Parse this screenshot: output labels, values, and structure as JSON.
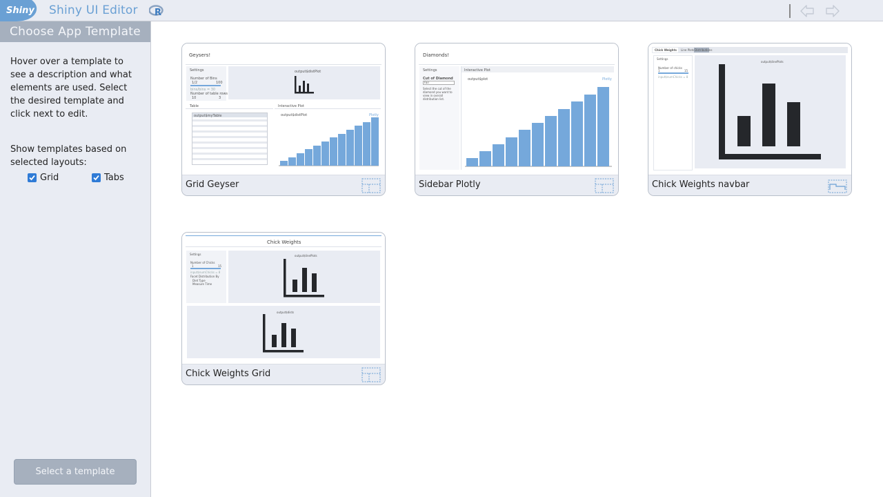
{
  "header": {
    "logo_text": "Shiny",
    "title": "Shiny UI Editor",
    "r_icon_text": "R",
    "icons": [
      "r-logo-icon",
      "undo-arrow-icon",
      "redo-arrow-icon"
    ]
  },
  "sidebar": {
    "title": "Choose App Template",
    "description": "Hover over a template to see a description and what elements are used. Select the desired template and click next to edit.",
    "layouts_text": "Show templates based on selected layouts:",
    "checkboxes": [
      {
        "label": "Grid",
        "checked": true
      },
      {
        "label": "Tabs",
        "checked": true
      }
    ],
    "select_button": "Select a template"
  },
  "templates": [
    {
      "name": "Grid Geyser",
      "layout_icon": "grid-layout-icon",
      "preview": {
        "title": "Geysers!",
        "settings_label": "Settings",
        "bins_label": "Number of Bins",
        "bins_min": "1/2",
        "bins_max": "100",
        "bins_note": "bins/bins = 30",
        "rows_label": "Number of table rows",
        "rows_min": "10",
        "rows_max": "3",
        "plot_label": "output$distPlot",
        "table_title": "Table",
        "table_label": "output$myTable",
        "interactive_title": "Interactive Plot",
        "interactive_label": "output$distPlot",
        "plotly_label": "Plotly"
      }
    },
    {
      "name": "Sidebar Plotly",
      "layout_icon": "grid-layout-icon",
      "preview": {
        "title": "Diamonds!",
        "settings_label": "Settings",
        "cut_label": "Cut of Diamond",
        "cut_value": "Fair",
        "cut_help": "Select the cut of the diamond you want to view in overall distribution list.",
        "plot_title": "Interactive Plot",
        "plot_label": "output$plot",
        "plotly_label": "Plotly"
      }
    },
    {
      "name": "Chick Weights navbar",
      "layout_icon": "tabs-layout-icon",
      "preview": {
        "brand": "Chick Weights",
        "tabs": [
          "Line Plots",
          "Distributions"
        ],
        "settings_label": "Settings",
        "chicks_label": "Number of chicks",
        "chicks_min": "1",
        "chicks_max": "15",
        "chicks_note": "input$numChicks = 8",
        "plot_label": "output$linePlots"
      }
    },
    {
      "name": "Chick Weights Grid",
      "layout_icon": "grid-layout-icon",
      "preview": {
        "title": "Chick Weights",
        "settings_label": "Settings",
        "chicks_label": "Number of Chicks",
        "chicks_min": "1",
        "chicks_max": "15",
        "chicks_note": "input$numChicks = 8",
        "facet_label": "Facet Distribution By",
        "facet_options": [
          "Diet Type",
          "Measure Time"
        ],
        "plot_label": "output$linePlots",
        "dists_label": "output$dists"
      }
    }
  ],
  "colors": {
    "accent": "#6aa0d4",
    "plot_blue": "#75a8db",
    "dark_bar": "#25272b",
    "panel_bg": "#e9ecf3",
    "header_gray": "#a6b0be",
    "checkbox_blue": "#2f7bd6"
  }
}
